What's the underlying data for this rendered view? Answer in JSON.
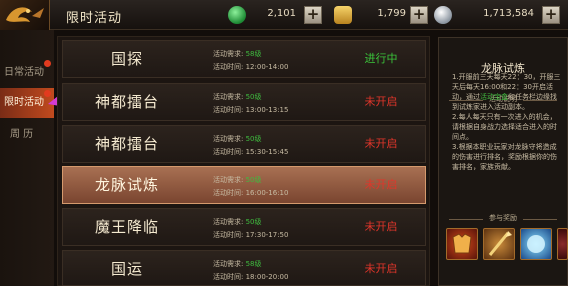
{
  "header": {
    "title": "限时活动",
    "currencies": [
      {
        "icon": "green-jade-icon",
        "value": "2,101",
        "color": "#2fb24a"
      },
      {
        "icon": "gold-ingot-icon",
        "value": "1,799",
        "color": "#e0b33a"
      },
      {
        "icon": "silver-coin-icon",
        "value": "1,713,584",
        "color": "#c8cfd8"
      }
    ]
  },
  "sidebar": {
    "tabs": [
      {
        "label": "日常活动",
        "active": false
      },
      {
        "label": "限时活动",
        "active": true
      },
      {
        "label": "周 历",
        "active": false
      }
    ]
  },
  "activities": [
    {
      "name": "国探",
      "req_label": "活动需求:",
      "req_level": "58级",
      "time_label": "活动时间:",
      "time": "12:00-14:00",
      "status": "进行中",
      "state": "open",
      "selected": false
    },
    {
      "name": "神都擂台",
      "req_label": "活动需求:",
      "req_level": "50级",
      "time_label": "活动时间:",
      "time": "13:00-13:15",
      "status": "未开启",
      "state": "closed",
      "selected": false
    },
    {
      "name": "神都擂台",
      "req_label": "活动需求:",
      "req_level": "50级",
      "time_label": "活动时间:",
      "time": "15:30-15:45",
      "status": "未开启",
      "state": "closed",
      "selected": false
    },
    {
      "name": "龙脉试炼",
      "req_label": "活动需求:",
      "req_level": "50级",
      "time_label": "活动时间:",
      "time": "16:00-16:10",
      "status": "未开启",
      "state": "closed",
      "selected": true
    },
    {
      "name": "魔王降临",
      "req_label": "活动需求:",
      "req_level": "50级",
      "time_label": "活动时间:",
      "time": "17:30-17:50",
      "status": "未开启",
      "state": "closed",
      "selected": false
    },
    {
      "name": "国运",
      "req_label": "活动需求:",
      "req_level": "58级",
      "time_label": "活动时间:",
      "time": "18:00-20:00",
      "status": "未开启",
      "state": "closed",
      "selected": false
    }
  ],
  "detail": {
    "title": "龙脉试炼",
    "desc_header": "活动说明",
    "desc_1a": "1.开服前三天每天22：30，开服三天后每天16:00和22：30开启活动，通过",
    "desc_1b": "活动宝盒",
    "desc_1c": "和任务栏边缘找到试炼家进入活动副本。",
    "desc_2": "2.每人每天只有一次进入的机会，请根据自身战力选择适合进入的时间点。",
    "desc_3": "3.根据本职业玩家对龙脉守将造成的伤害进行排名，奖励根据你的伤害排名，家族贡献。",
    "reward_header": "参与奖励",
    "rewards": [
      {
        "icon": "armor-chest-icon"
      },
      {
        "icon": "golden-spear-icon"
      },
      {
        "icon": "blue-orb-icon"
      }
    ]
  }
}
